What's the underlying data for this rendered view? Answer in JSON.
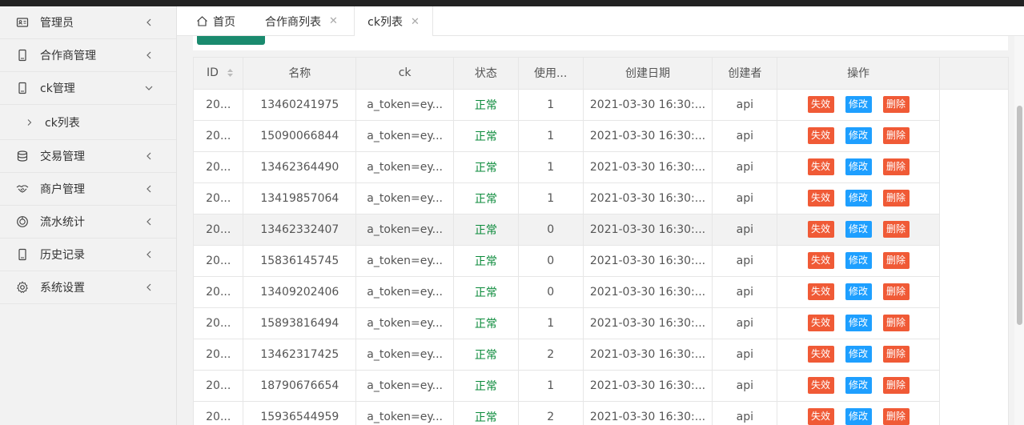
{
  "sidebar": {
    "items": [
      {
        "label": "管理员",
        "icon": "id-card-icon"
      },
      {
        "label": "合作商管理",
        "icon": "phone-icon"
      },
      {
        "label": "ck管理",
        "icon": "phone-icon",
        "expanded": true
      },
      {
        "label": "交易管理",
        "icon": "database-icon"
      },
      {
        "label": "商户管理",
        "icon": "handshake-icon"
      },
      {
        "label": "流水统计",
        "icon": "chart-icon"
      },
      {
        "label": "历史记录",
        "icon": "phone-icon"
      },
      {
        "label": "系统设置",
        "icon": "gear-icon"
      }
    ],
    "sub_item": "ck列表"
  },
  "tabs": [
    {
      "label": "首页"
    },
    {
      "label": "合作商列表"
    },
    {
      "label": "ck列表",
      "active": true
    }
  ],
  "table": {
    "headers": [
      "ID",
      "名称",
      "ck",
      "状态",
      "使用...",
      "创建日期",
      "创建者",
      "操作"
    ],
    "actions": [
      "失效",
      "修改",
      "删除"
    ],
    "rows": [
      [
        "20...",
        "13460241975",
        "a_token=ey...",
        "正常",
        "1",
        "2021-03-30 16:30:...",
        "api"
      ],
      [
        "20...",
        "15090066844",
        "a_token=ey...",
        "正常",
        "1",
        "2021-03-30 16:30:...",
        "api"
      ],
      [
        "20...",
        "13462364490",
        "a_token=ey...",
        "正常",
        "1",
        "2021-03-30 16:30:...",
        "api"
      ],
      [
        "20...",
        "13419857064",
        "a_token=ey...",
        "正常",
        "1",
        "2021-03-30 16:30:...",
        "api"
      ],
      [
        "20...",
        "13462332407",
        "a_token=ey...",
        "正常",
        "0",
        "2021-03-30 16:30:...",
        "api"
      ],
      [
        "20...",
        "15836145745",
        "a_token=ey...",
        "正常",
        "0",
        "2021-03-30 16:30:...",
        "api"
      ],
      [
        "20...",
        "13409202406",
        "a_token=ey...",
        "正常",
        "0",
        "2021-03-30 16:30:...",
        "api"
      ],
      [
        "20...",
        "15893816494",
        "a_token=ey...",
        "正常",
        "1",
        "2021-03-30 16:30:...",
        "api"
      ],
      [
        "20...",
        "13462317425",
        "a_token=ey...",
        "正常",
        "2",
        "2021-03-30 16:30:...",
        "api"
      ],
      [
        "20...",
        "18790676654",
        "a_token=ey...",
        "正常",
        "1",
        "2021-03-30 16:30:...",
        "api"
      ],
      [
        "20...",
        "15936544959",
        "a_token=ey...",
        "正常",
        "2",
        "2021-03-30 16:30:...",
        "api"
      ]
    ]
  },
  "colors": {
    "status_ok": "#0a8a3a",
    "btn_red": "#f05a36",
    "btn_blue": "#1e9fff",
    "accent_green": "#1a8a6e"
  }
}
